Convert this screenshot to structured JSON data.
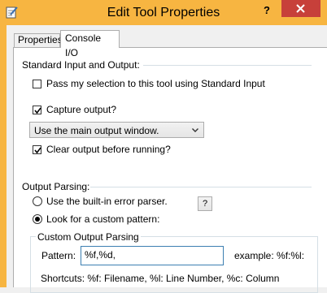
{
  "window": {
    "title": "Edit Tool Properties",
    "help_label": "?",
    "accent": "#f7b541",
    "close_color": "#c7403a"
  },
  "tabs": [
    {
      "label": "Properties"
    },
    {
      "label": "Console I/O"
    }
  ],
  "standard_io": {
    "heading": "Standard Input and Output:",
    "pass_selection": {
      "label": "Pass my selection to this tool using Standard Input",
      "checked": false
    },
    "capture_output": {
      "label": "Capture output?",
      "checked": true
    },
    "output_target": {
      "value": "Use the main output window."
    },
    "clear_output": {
      "label": "Clear output before running?",
      "checked": true
    }
  },
  "output_parsing": {
    "heading": "Output Parsing:",
    "builtin": {
      "label": "Use the built-in error parser.",
      "selected": false
    },
    "builtin_help": "?",
    "custom": {
      "label": "Look for a custom pattern:",
      "selected": true
    },
    "custom_group": {
      "legend": "Custom Output Parsing",
      "pattern_label": "Pattern:",
      "pattern_value": "%f,%d,",
      "example": "example: %f:%l:",
      "shortcuts": "Shortcuts:  %f: Filename, %l: Line Number, %c: Column"
    }
  }
}
